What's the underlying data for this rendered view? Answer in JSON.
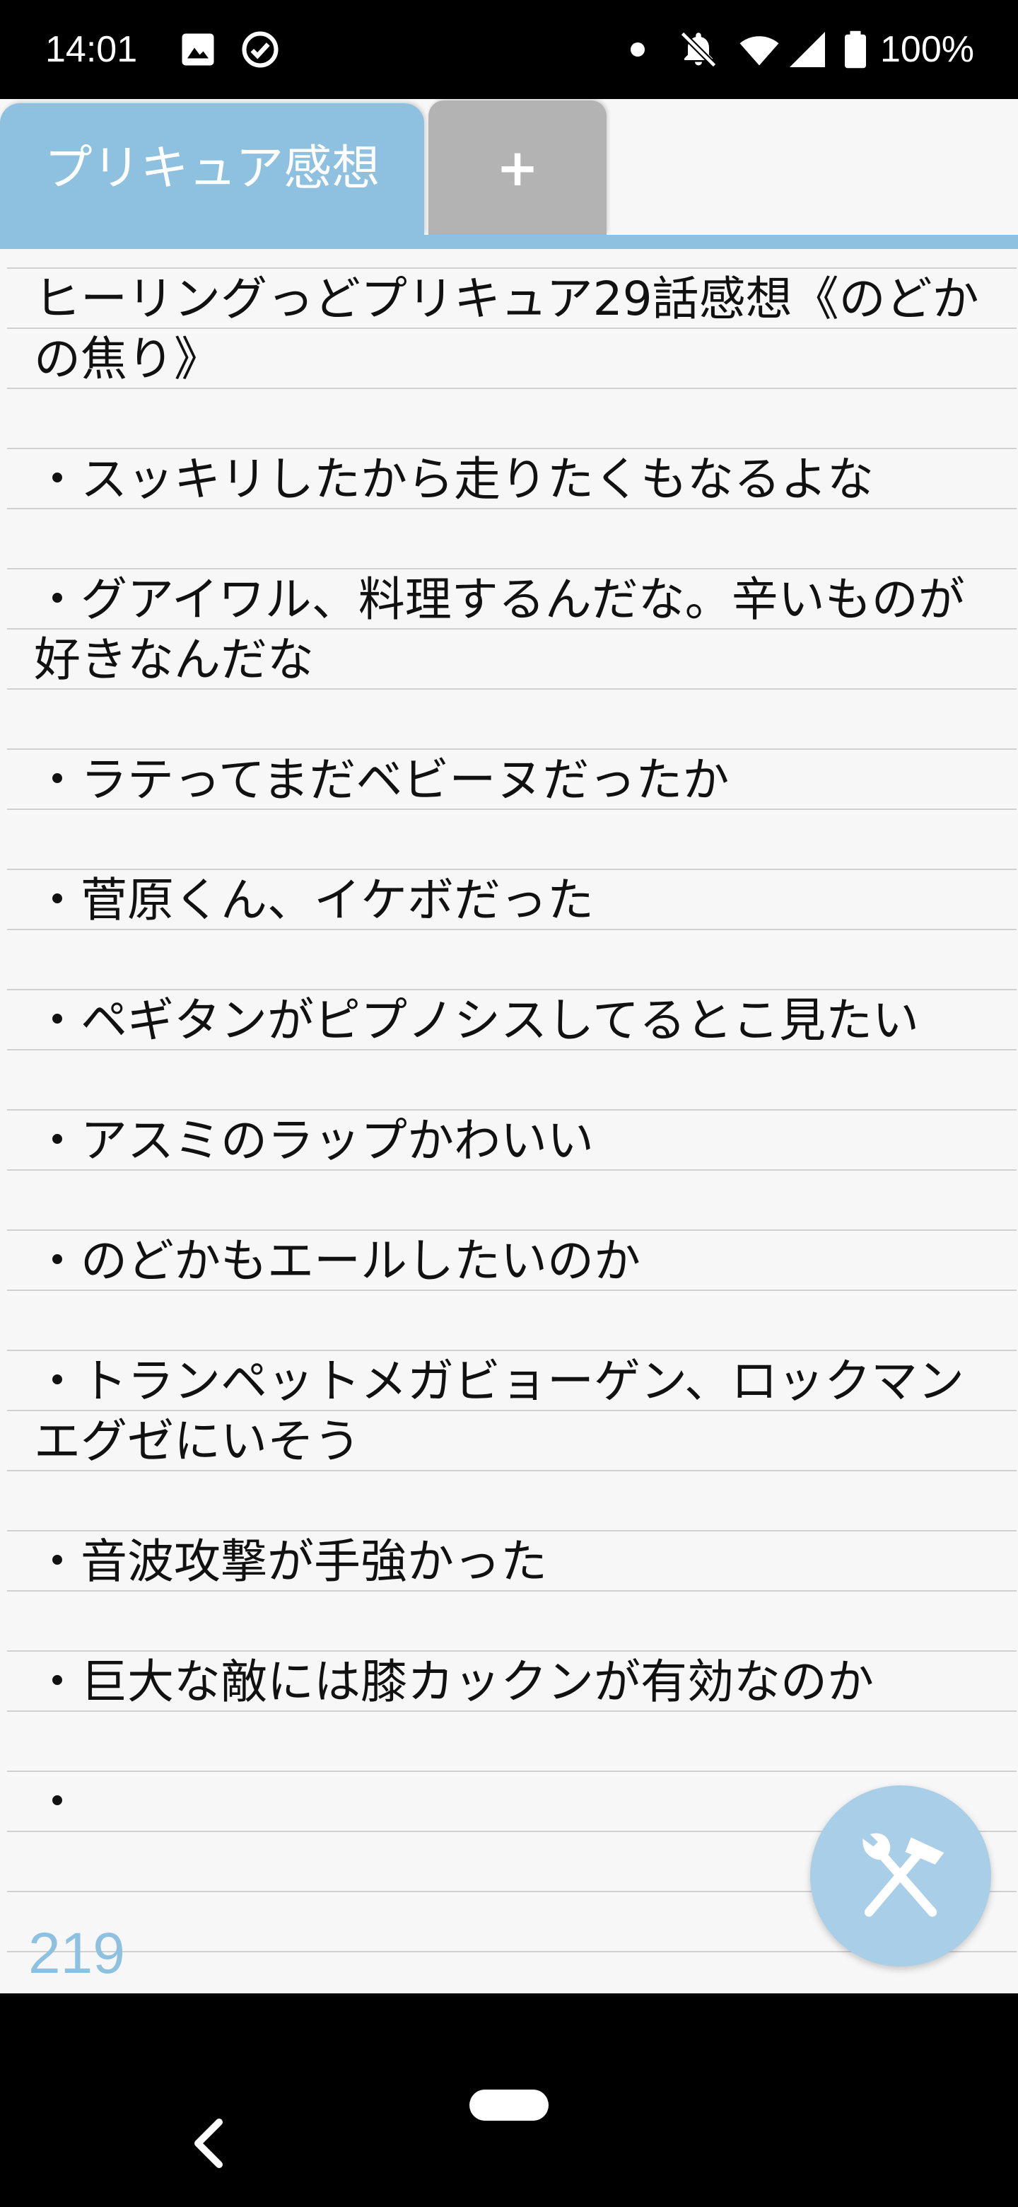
{
  "status_bar": {
    "time": "14:01",
    "battery": "100%",
    "icons": [
      "image-icon",
      "check-circle-icon",
      "dot-icon",
      "notifications-off-icon",
      "wifi-icon",
      "signal-icon",
      "battery-icon"
    ]
  },
  "tabs": [
    {
      "label": "プリキュア感想",
      "active": true
    },
    {
      "label": "+",
      "active": false
    }
  ],
  "editor": {
    "lines": [
      "ヒーリングっどプリキュア29話感想《のどかの焦り》",
      "",
      "・スッキリしたから走りたくもなるよな",
      "",
      "・グアイワル、料理するんだな。辛いものが好きなんだな",
      "",
      "・ラテってまだベビーヌだったか",
      "",
      "・菅原くん、イケボだった",
      "",
      "・ペギタンがピプノシスしてるとこ見たい",
      "",
      "・アスミのラップかわいい",
      "",
      "・のどかもエールしたいのか",
      "",
      "・トランペットメガビョーゲン、ロックマンエグゼにいそう",
      "",
      "・音波攻撃が手強かった",
      "",
      "・巨大な敵には膝カックンが有効なのか",
      "",
      "・"
    ],
    "char_count": "219"
  },
  "fab": {
    "icon": "tools-icon"
  },
  "nav": {
    "back_icon": "back-chevron-icon",
    "home": "home-pill"
  },
  "colors": {
    "accent": "#8ec1e0",
    "fab": "#a9cfe8",
    "inactive_tab": "#b3b3b3"
  }
}
